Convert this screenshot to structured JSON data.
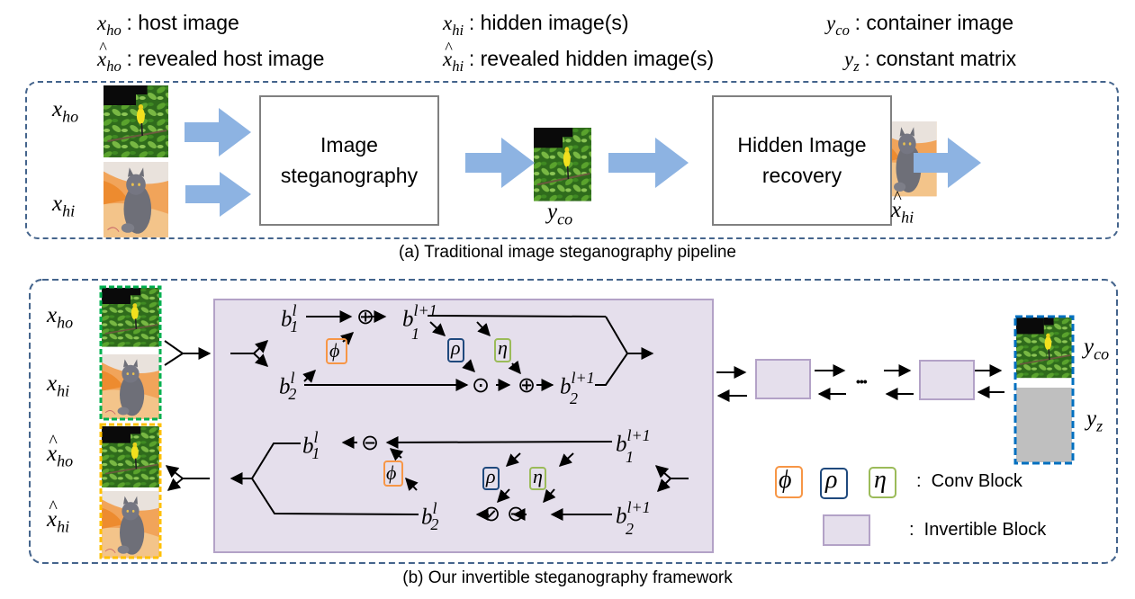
{
  "legend": {
    "items": [
      {
        "symbol": "x",
        "subscript": "ho",
        "hat": false,
        "description": "host image"
      },
      {
        "symbol": "x",
        "subscript": "hi",
        "hat": false,
        "description": "hidden image(s)"
      },
      {
        "symbol": "y",
        "subscript": "co",
        "hat": false,
        "description": "container image"
      },
      {
        "symbol": "x",
        "subscript": "ho",
        "hat": true,
        "description": "revealed host image"
      },
      {
        "symbol": "x",
        "subscript": "hi",
        "hat": true,
        "description": "revealed hidden image(s)"
      },
      {
        "symbol": "y",
        "subscript": "z",
        "hat": false,
        "description": "constant matrix"
      }
    ]
  },
  "panel_a": {
    "caption": "(a) Traditional image steganography pipeline",
    "inputs": [
      {
        "symbol": "x",
        "subscript": "ho",
        "image": "bird-on-branch"
      },
      {
        "symbol": "x",
        "subscript": "hi",
        "image": "grey-cat-on-orange-couch"
      }
    ],
    "stego_box": {
      "line1": "Image",
      "line2": "steganography"
    },
    "container": {
      "symbol": "y",
      "subscript": "co",
      "image": "bird-on-branch"
    },
    "recovery_box": {
      "line1": "Hidden Image",
      "line2": "recovery"
    },
    "output": {
      "symbol": "x",
      "subscript": "hi",
      "hat": true,
      "image": "grey-cat-on-orange-couch"
    },
    "arrow_color": "#8db3e2"
  },
  "panel_b": {
    "caption": "(b) Our invertible steganography framework",
    "inputs": [
      {
        "symbol": "x",
        "subscript": "ho",
        "hat": false
      },
      {
        "symbol": "x",
        "subscript": "hi",
        "hat": false
      },
      {
        "symbol": "x",
        "subscript": "ho",
        "hat": true
      },
      {
        "symbol": "x",
        "subscript": "hi",
        "hat": true
      }
    ],
    "forward": {
      "b1_in": {
        "base": "b",
        "sub": "1",
        "sup": "l"
      },
      "b2_in": {
        "base": "b",
        "sub": "2",
        "sup": "l"
      },
      "b1_out": {
        "base": "b",
        "sub": "1",
        "sup": "l+1"
      },
      "b2_out": {
        "base": "b",
        "sub": "2",
        "sup": "l+1"
      },
      "ops": {
        "add": "⊕",
        "mul": "⊙"
      }
    },
    "backward": {
      "b1_in": {
        "base": "b",
        "sub": "1",
        "sup": "l+1"
      },
      "b2_in": {
        "base": "b",
        "sub": "2",
        "sup": "l+1"
      },
      "b1_out": {
        "base": "b",
        "sub": "1",
        "sup": "l"
      },
      "b2_out": {
        "base": "b",
        "sub": "2",
        "sup": "l"
      },
      "ops": {
        "sub": "⊖",
        "div": "⊘"
      }
    },
    "conv_blocks": [
      {
        "symbol": "ϕ",
        "color": "#f79646"
      },
      {
        "symbol": "ρ",
        "color": "#1f497d"
      },
      {
        "symbol": "η",
        "color": "#9bbb59"
      }
    ],
    "ellipsis": "•••",
    "outputs": [
      {
        "symbol": "y",
        "subscript": "co"
      },
      {
        "symbol": "y",
        "subscript": "z"
      }
    ],
    "legend": {
      "conv_block_label": ":  Conv Block",
      "invertible_block_label": ":  Invertible Block"
    },
    "colors": {
      "invertible_fill": "#e5dfec",
      "invertible_border": "#b3a2c7",
      "input_frame": "#00b050",
      "revealed_frame": "#ffc000",
      "output_frame": "#0070c0",
      "constant_fill": "#bfbfbf",
      "panel_border": "#44648c"
    }
  }
}
